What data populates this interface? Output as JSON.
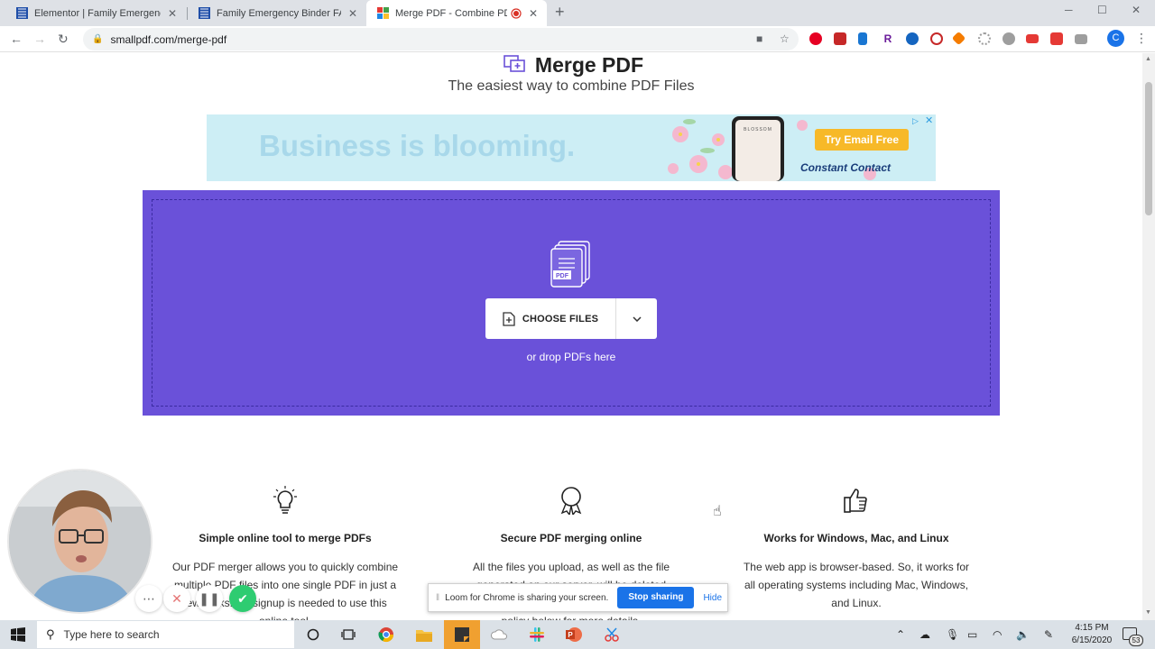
{
  "browser": {
    "tabs": [
      {
        "title": "Elementor | Family Emergency Bi",
        "close": "✕",
        "active": false
      },
      {
        "title": "Family Emergency Binder FAQ - S",
        "close": "✕",
        "active": false
      },
      {
        "title": "Merge PDF - Combine PDF f",
        "close": "✕",
        "active": true
      }
    ],
    "new_tab": "+",
    "url": "smallpdf.com/merge-pdf",
    "profile_initial": "C"
  },
  "page": {
    "title": "Merge PDF",
    "subtitle": "The easiest way to combine PDF Files",
    "ad": {
      "headline": "Business is blooming.",
      "phone_brand": "BLOSSOM",
      "cta": "Try Email Free",
      "advertiser": "Constant Contact"
    },
    "dropzone": {
      "choose_label": "CHOOSE FILES",
      "drop_text": "or drop PDFs here",
      "icon_badge": "PDF"
    },
    "features": [
      {
        "icon": "lightbulb-icon",
        "title": "Simple online tool to merge PDFs",
        "desc": "Our PDF merger allows you to quickly combine multiple PDF files into one single PDF in just a few clicks. No signup is needed to use this online tool."
      },
      {
        "icon": "award-icon",
        "title": "Secure PDF merging online",
        "desc": "All the files you upload, as well as the file generated on our server, will be deleted permanently within an hour. Read the privacy policy below for more details."
      },
      {
        "icon": "thumbs-up-icon",
        "title": "Works for Windows, Mac, and Linux",
        "desc": "The web app is browser-based. So, it works for all operating systems including Mac, Windows, and Linux."
      }
    ]
  },
  "loom": {
    "share_message": "Loom for Chrome is sharing your screen.",
    "stop_label": "Stop sharing",
    "hide_label": "Hide"
  },
  "taskbar": {
    "search_placeholder": "Type here to search",
    "time": "4:15 PM",
    "date": "6/15/2020",
    "notification_count": "53"
  },
  "colors": {
    "dropzone": "#6a51d9",
    "accent_blue": "#1a73e8",
    "ad_button": "#f7b928"
  }
}
